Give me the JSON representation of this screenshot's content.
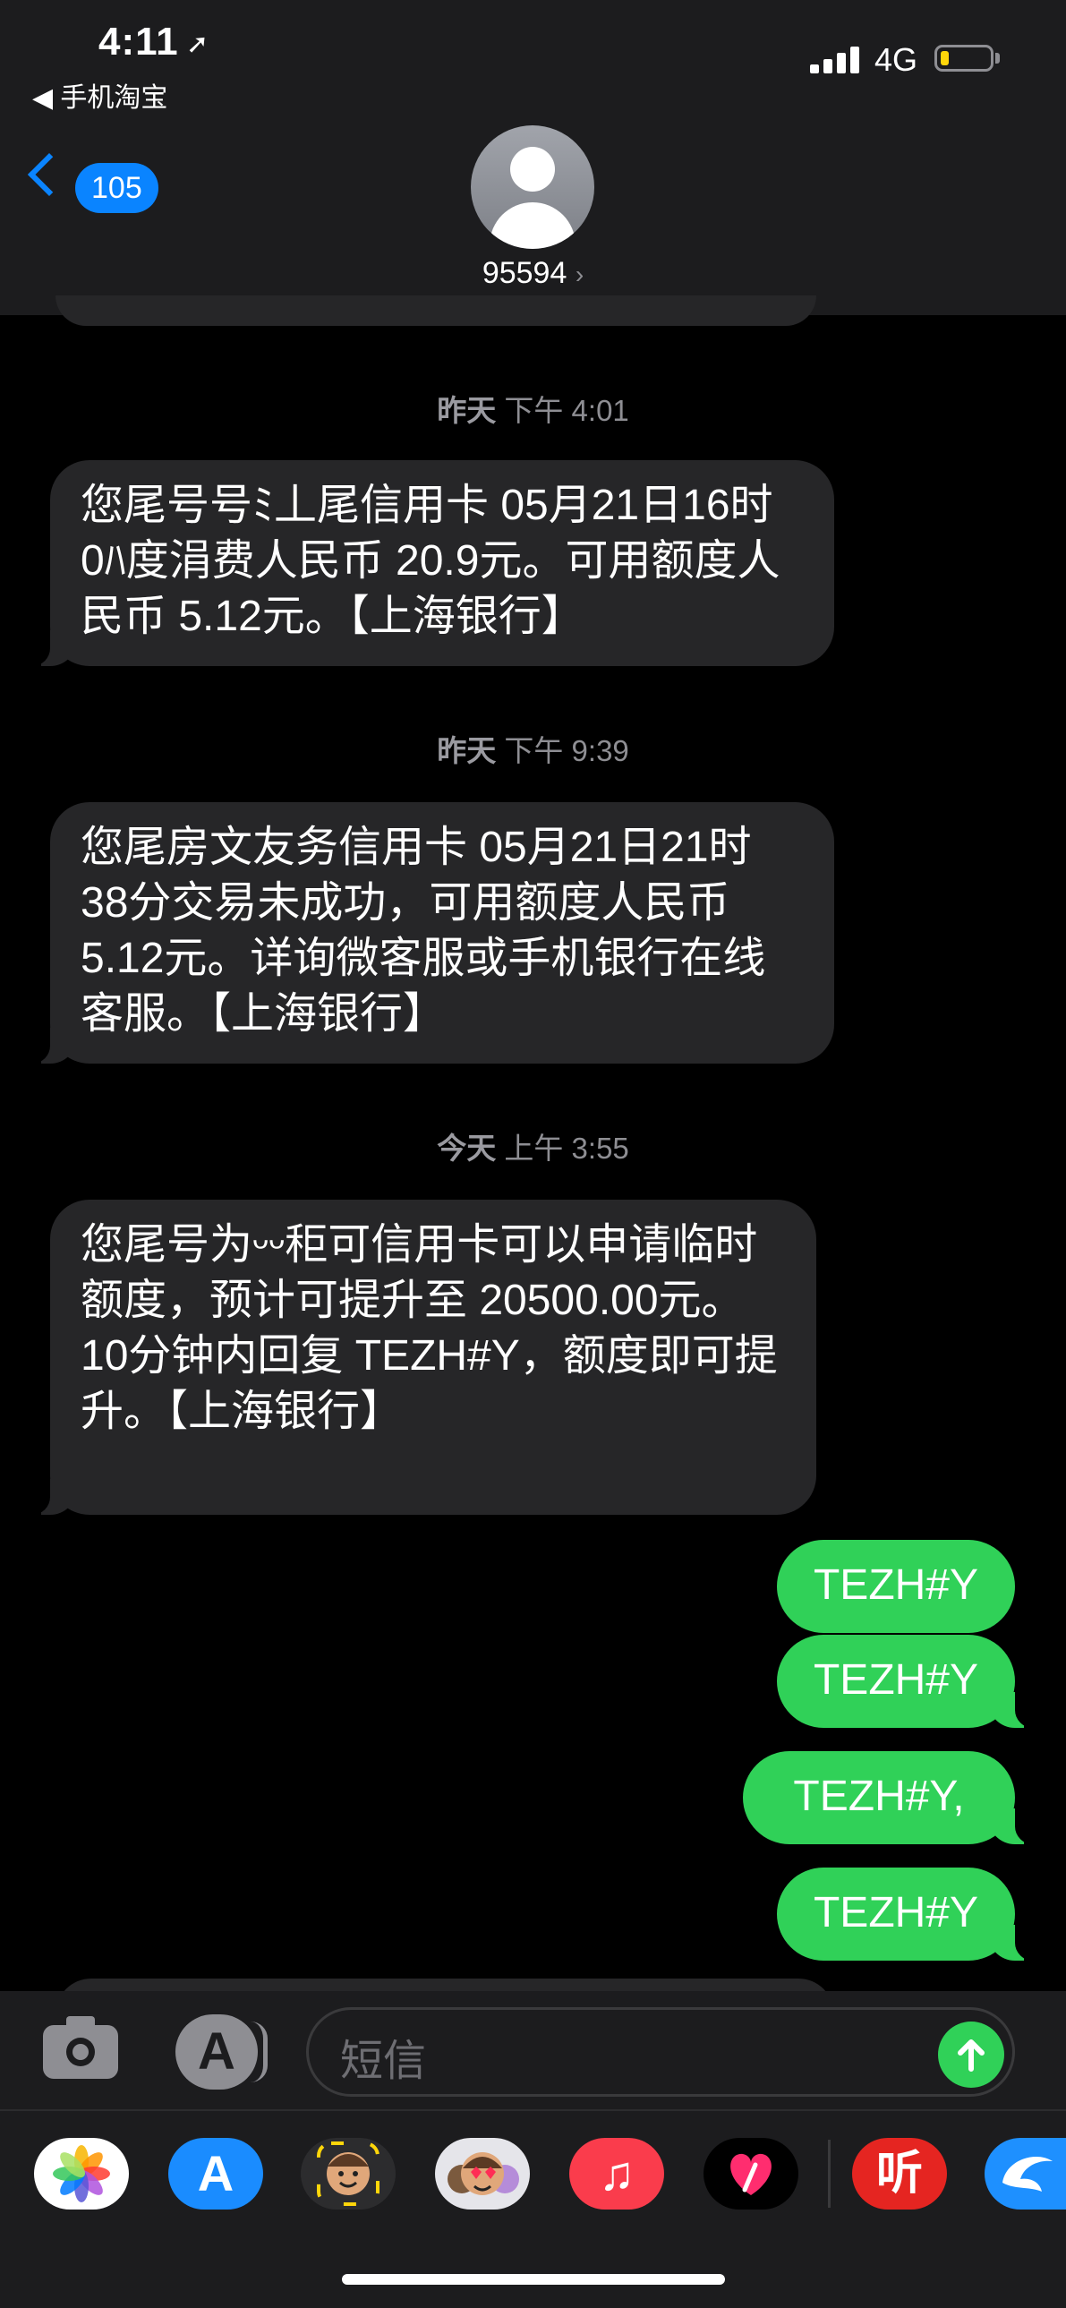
{
  "status_bar": {
    "time": "4:11",
    "back_app": "◀ 手机淘宝",
    "network": "4G"
  },
  "header": {
    "back_badge": "105",
    "contact_name": "95594",
    "contact_chevron": "›"
  },
  "messages": [
    {
      "timestamp_day": "昨天",
      "timestamp_time": "下午 4:01",
      "text": "您尾号号ﾐ丄尾信用卡 05月21日16时 0ﾊ度涓费人民币 20.9元。可用额度人民币 5.12元。【上海银行】"
    },
    {
      "timestamp_day": "昨天",
      "timestamp_time": "下午 9:39",
      "text": "您尾房文友务信用卡 05月21日21时 38分交易未成功，可用额度人民币 5.12元。详询微客服或手机银行在线客服。【上海银行】"
    },
    {
      "timestamp_day": "今天",
      "timestamp_time": "上午 3:55",
      "text": "您尾号为ᵕᵕ秬可信用卡可以申请临时额度，预计可提升至 20500.00元。10分钟内回复 TEZH#Y，额度即可提升。【上海银行】"
    }
  ],
  "sent": [
    "TEZH#Y",
    "TEZH#Y",
    "TEZH#Y,",
    "TEZH#Y"
  ],
  "input": {
    "placeholder": "短信"
  },
  "tray_apps": [
    {
      "icon": "photos-icon",
      "bg": "#ffffff"
    },
    {
      "icon": "app-store-icon",
      "bg": "#1a8cff"
    },
    {
      "icon": "memoji-icon",
      "bg": "#2c2c2e"
    },
    {
      "icon": "animoji-icon",
      "bg": "#e5e5ea"
    },
    {
      "icon": "music-icon",
      "bg": "#fa3c4c"
    },
    {
      "icon": "digital-touch-icon",
      "bg": "#000000"
    },
    {
      "icon": "ting-icon",
      "bg": "#e52521",
      "label": "听"
    },
    {
      "icon": "dolphin-app-icon",
      "bg": "#1e90ff"
    }
  ],
  "colors": {
    "incoming_bubble": "#262628",
    "outgoing_bubble": "#30d158",
    "accent": "#0a84ff"
  }
}
